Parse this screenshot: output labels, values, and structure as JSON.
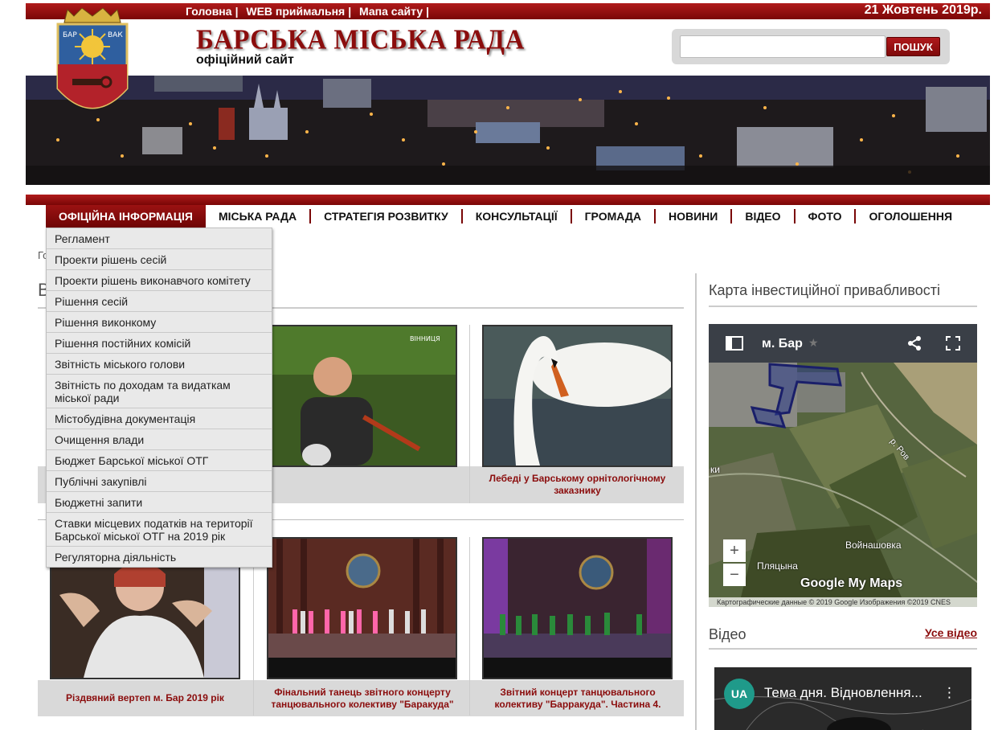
{
  "topbar": {
    "links": [
      "Головна",
      "WEB приймальня",
      "Мапа сайту"
    ],
    "separator": "|",
    "date": "21 Жовтень 2019р."
  },
  "header": {
    "title": "БАРСЬКА МІСЬКА РАДА",
    "subtitle": "офіційний сайт",
    "coat_letters": [
      "БАР",
      "ВАК"
    ]
  },
  "search": {
    "placeholder": "",
    "button_label": "ПОШУК"
  },
  "nav": {
    "items": [
      "ОФІЦІЙНА ІНФОРМАЦІЯ",
      "МІСЬКА РАДА",
      "СТРАТЕГІЯ РОЗВИТКУ",
      "КОНСУЛЬТАЦІЇ",
      "ГРОМАДА",
      "НОВИНИ",
      "ВІДЕО",
      "ФОТО",
      "ОГОЛОШЕННЯ"
    ],
    "active_index": 0
  },
  "dropdown": {
    "items": [
      "Регламент",
      "Проекти рішень сесій",
      "Проекти рішень виконавчого комітету",
      "Рішення сесій",
      "Рішення виконкому",
      "Рішення постійних комісій",
      "Звітність міського голови",
      "Звітність по доходам та видаткам міської ради",
      "Містобудівна документація",
      "Очищення влади",
      "Бюджет Барської міської ОТГ",
      "Публічні закупівлі",
      "Бюджетні запити",
      "Ставки місцевих податків на території Барської міської ОТГ на 2019 рік",
      "Регуляторна діяльність"
    ]
  },
  "content": {
    "breadcrumb_stub": "Го",
    "section_stub": "В",
    "thumb_watermark": "ВІННИЦЯ",
    "cards_row1": [
      {
        "caption": "Лебеді у Барському орнітологічному заказнику"
      }
    ],
    "cards_row2": [
      {
        "caption": "Різдвяний вертеп м. Бар 2019 рік"
      },
      {
        "caption": "Фінальний танець звітного концерту танцювального колективу \"Баракуда\""
      },
      {
        "caption": "Звітний концерт танцювального колективу \"Барракуда\". Частина 4."
      }
    ]
  },
  "sidebar": {
    "invest_title": "Карта інвестиційної привабливості",
    "map": {
      "title": "м. Бар",
      "labels": [
        "ки",
        "р. Ров",
        "Войнашовка",
        "Пляцына"
      ],
      "zoom_in": "+",
      "zoom_out": "−",
      "logo": "Google My Maps",
      "credit": "Картографические данные © 2019 Google Изображения ©2019 CNES"
    },
    "video_title": "Відео",
    "video_all_label": "Усе відео",
    "video": {
      "channel": "UA",
      "title": "Тема дня. Відновлення...",
      "menu": "⋮"
    }
  },
  "colors": {
    "brand_red": "#8b0d0d",
    "bar_red": "#7a0606"
  }
}
